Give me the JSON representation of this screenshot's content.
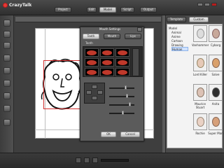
{
  "app": {
    "logo_text": "CrazyTalk",
    "logo_version": "6",
    "top_tabs": [
      "Project",
      "Edit",
      "Model",
      "Script",
      "Output"
    ],
    "active_tab": "Model"
  },
  "right_panel": {
    "tabs": [
      "Template",
      "Custom"
    ],
    "tree": [
      "Model",
      "Animal",
      "Anime",
      "Cartoon",
      "Drawing",
      "Human"
    ],
    "selected_tree": "Human",
    "gallery": [
      {
        "name": "Vanhammer"
      },
      {
        "name": "Cyborg"
      },
      {
        "name": "Lord Killer"
      },
      {
        "name": "Salve"
      },
      {
        "name": "Maurice Stuart"
      },
      {
        "name": "Anita"
      },
      {
        "name": "Rochie"
      },
      {
        "name": "Super Man"
      }
    ]
  },
  "dialog": {
    "title": "Mouth Settings",
    "tabs": [
      "Teeth",
      "Mouth",
      "Lips"
    ],
    "active_tab": "Teeth",
    "teeth_label": "Teeth",
    "ok_label": "OK",
    "cancel_label": "Cancel"
  },
  "canvas": {
    "zoom": "100%"
  },
  "colors": {
    "accent": "#c62828",
    "panel_dark": "#4a4a4a",
    "dialog_bg": "#5b5b5b"
  }
}
